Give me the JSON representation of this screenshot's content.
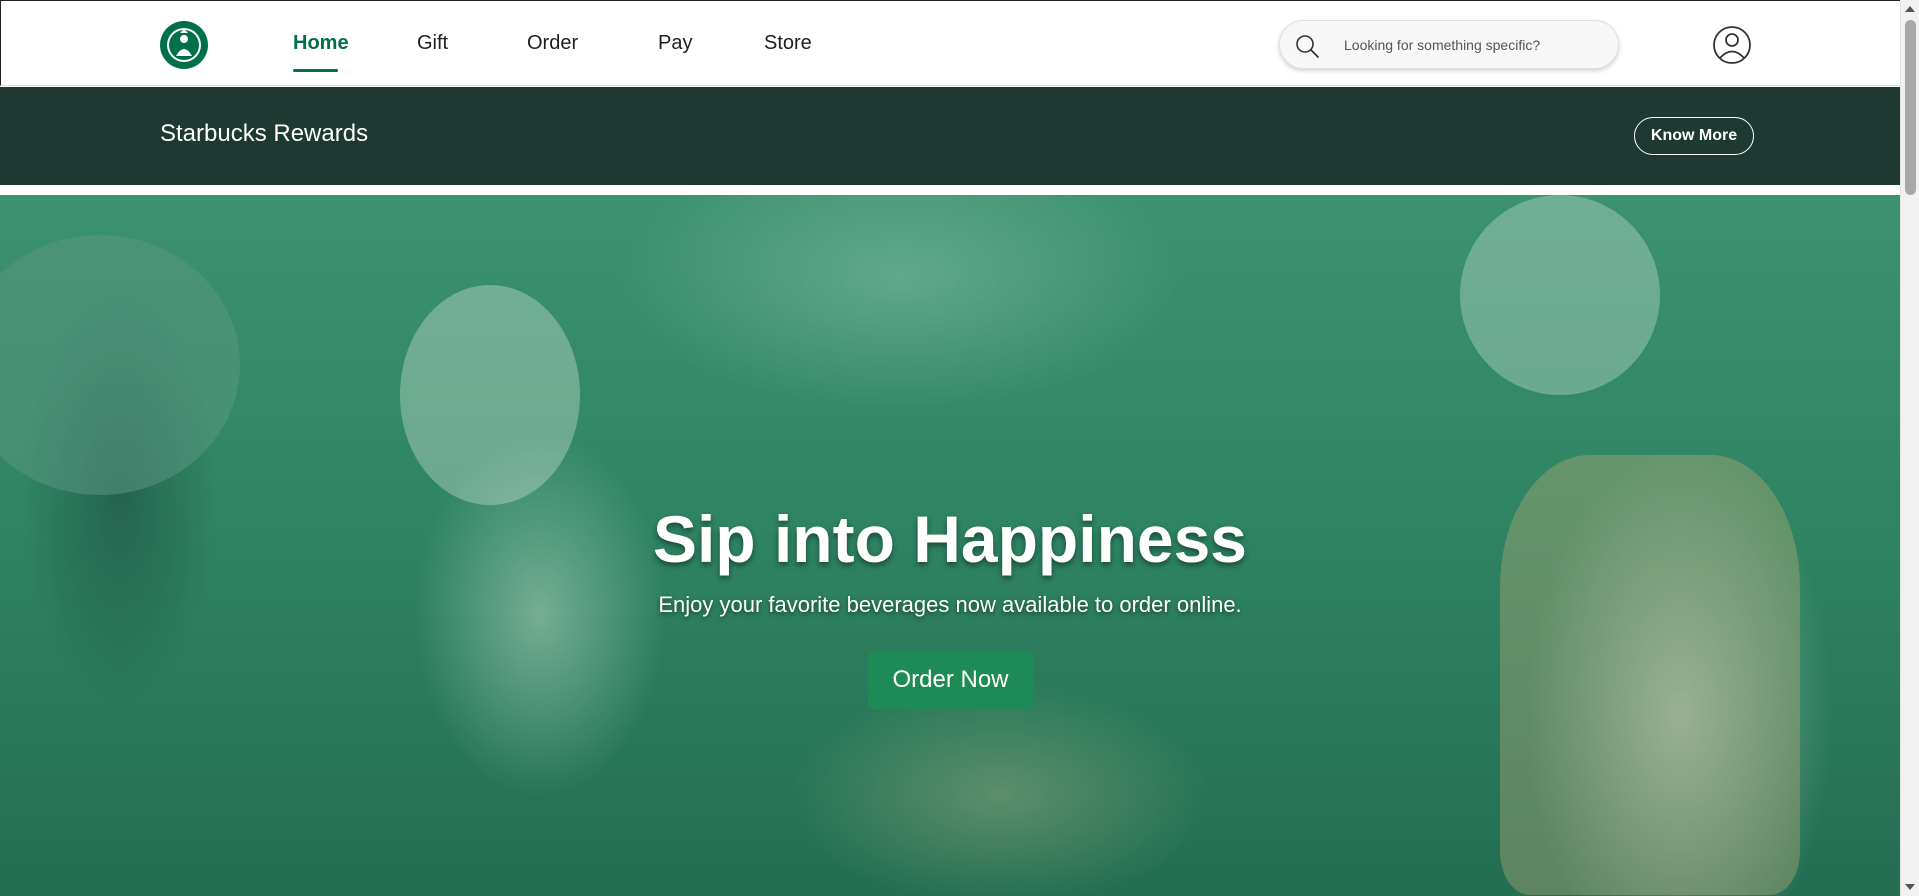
{
  "header": {
    "logo_name": "starbucks-siren-logo",
    "nav": [
      {
        "label": "Home",
        "active": true
      },
      {
        "label": "Gift",
        "active": false
      },
      {
        "label": "Order",
        "active": false
      },
      {
        "label": "Pay",
        "active": false
      },
      {
        "label": "Store",
        "active": false
      }
    ],
    "search": {
      "placeholder": "Looking for something specific?",
      "value": ""
    },
    "account_icon": "user-circle-icon"
  },
  "rewards": {
    "title": "Starbucks Rewards",
    "button_label": "Know More"
  },
  "hero": {
    "headline": "Sip into Happiness",
    "subtext": "Enjoy your favorite beverages now available to order online.",
    "cta_label": "Order Now"
  },
  "colors": {
    "brand_green": "#00704a",
    "rewards_bg": "#1e3932",
    "cta_green": "#1e8a55"
  }
}
